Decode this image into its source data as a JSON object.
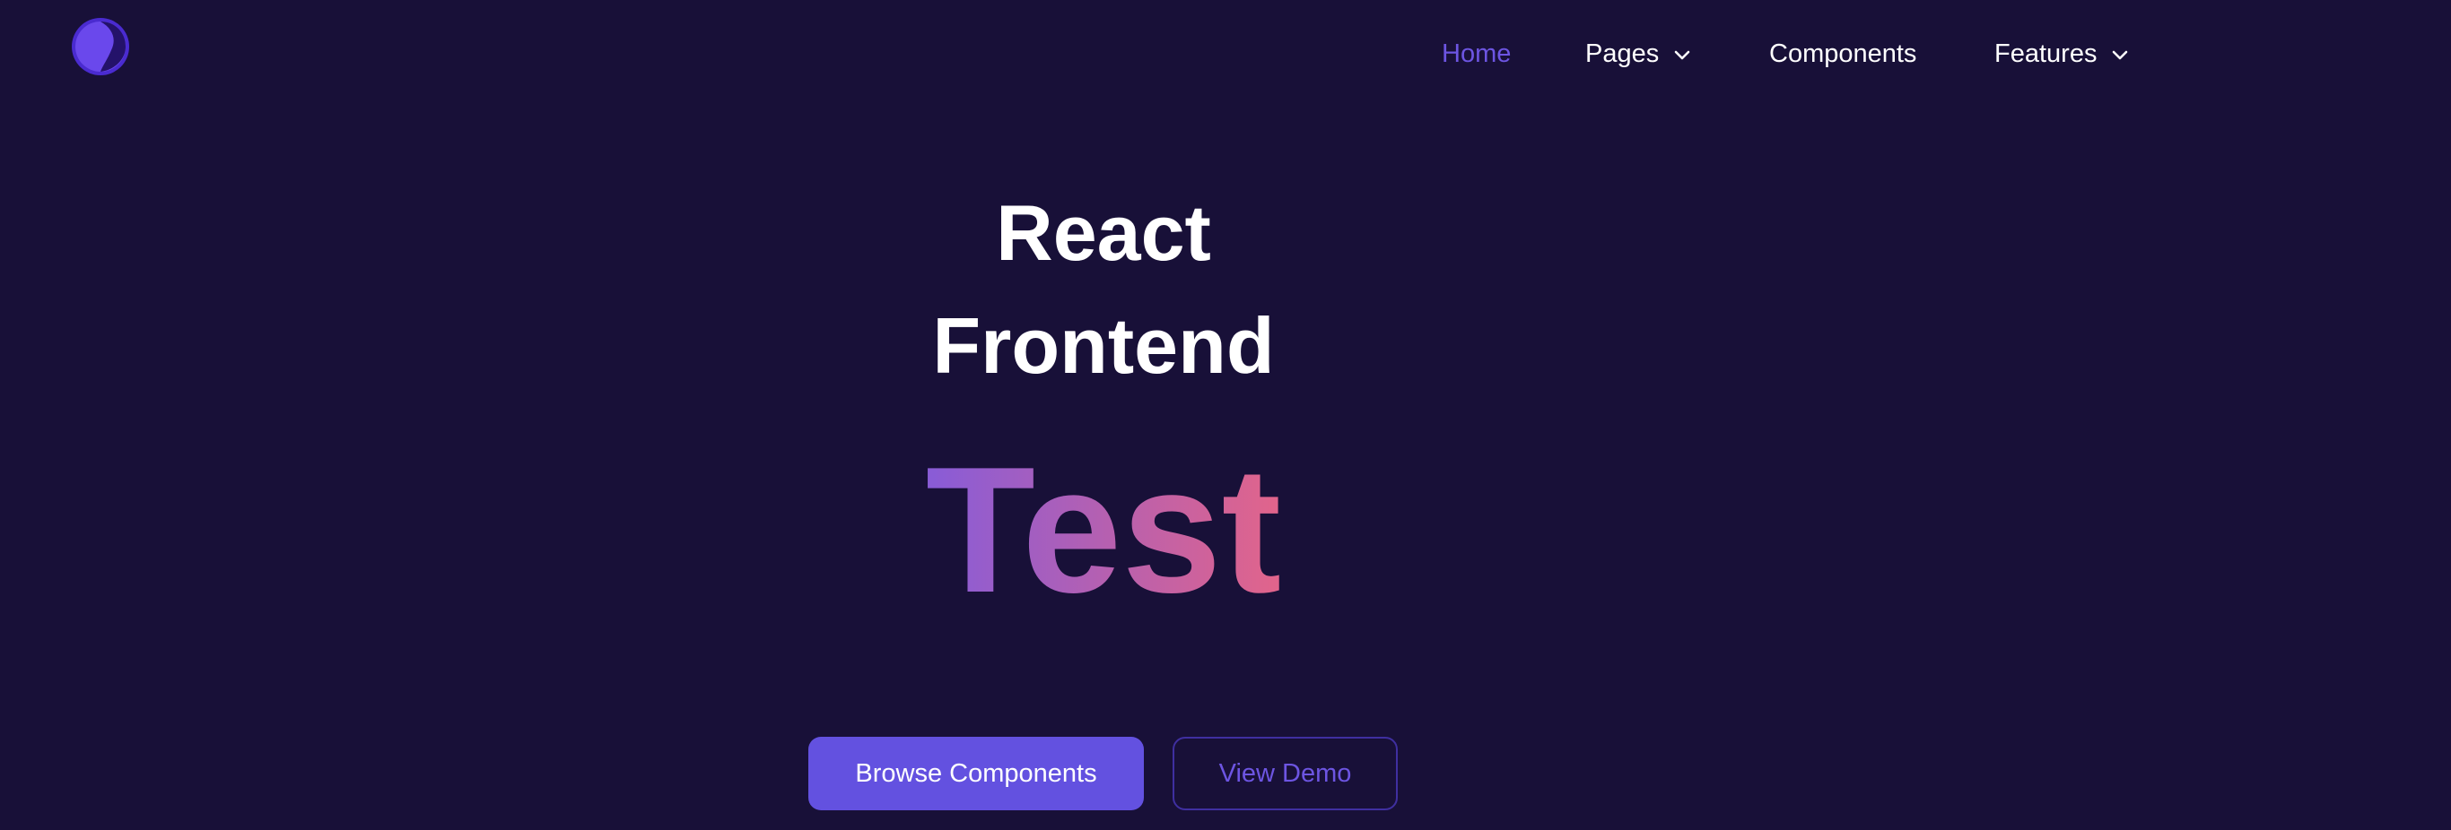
{
  "brand": {
    "logo_icon": "crescent-moon-logo-icon",
    "accent_color": "#6351e0"
  },
  "nav": {
    "items": [
      {
        "label": "Home",
        "active": true
      },
      {
        "label": "Pages",
        "has_dropdown": true
      },
      {
        "label": "Components"
      },
      {
        "label": "Features",
        "has_dropdown": true
      }
    ]
  },
  "hero": {
    "line1": "React",
    "line2": "Frontend",
    "accent": "Test",
    "accent_gradient": [
      "#8a5cd6",
      "#e0648c"
    ]
  },
  "actions": {
    "primary_label": "Browse Components",
    "secondary_label": "View Demo"
  },
  "colors": {
    "background": "#181038",
    "nav_active": "#6d55e2",
    "text": "#ffffff"
  }
}
